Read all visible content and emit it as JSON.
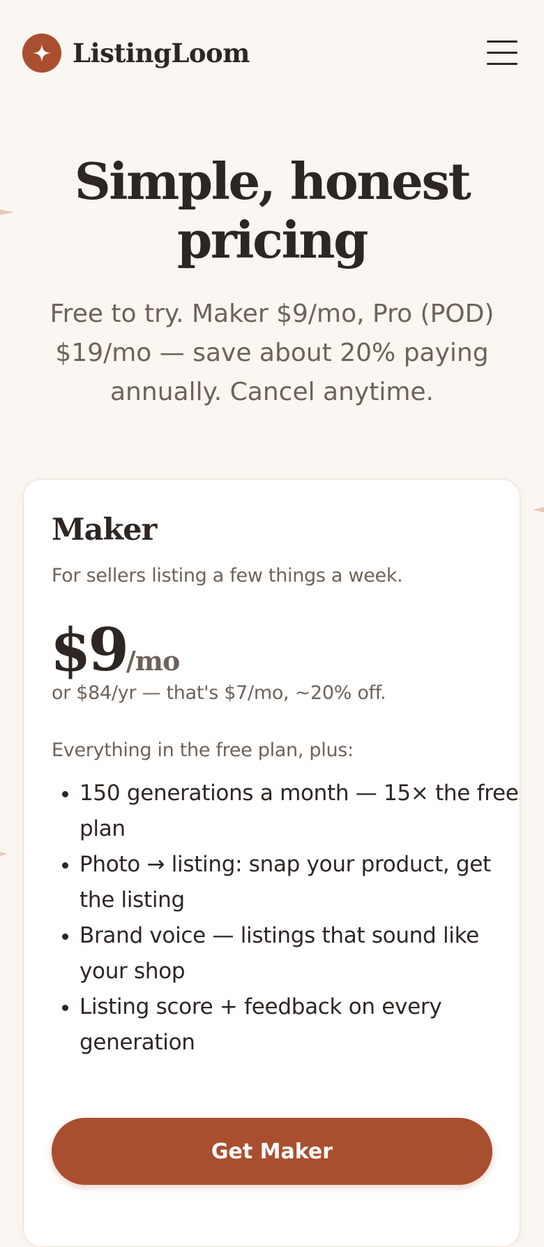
{
  "brand": {
    "name": "ListingLoom",
    "logo_icon": "sparkle-icon",
    "accent_color": "#a94f30"
  },
  "header": {
    "menu_icon": "hamburger-menu-icon"
  },
  "hero": {
    "title": "Simple, honest pricing",
    "subtitle": "Free to try. Maker $9/mo, Pro (POD) $19/mo — save about 20% paying annually. Cancel anytime."
  },
  "plan": {
    "name": "Maker",
    "description": "For sellers listing a few things a week.",
    "price": "$9",
    "period": "/mo",
    "annual_note": "or $84/yr — that's $7/mo, ~20% off.",
    "includes_label": "Everything in the free plan, plus:",
    "features": [
      "150 generations a month — 15× the free plan",
      "Photo → listing: snap your product, get the listing",
      "Brand voice — listings that sound like your shop",
      "Listing score + feedback on every generation"
    ],
    "cta_label": "Get Maker"
  }
}
